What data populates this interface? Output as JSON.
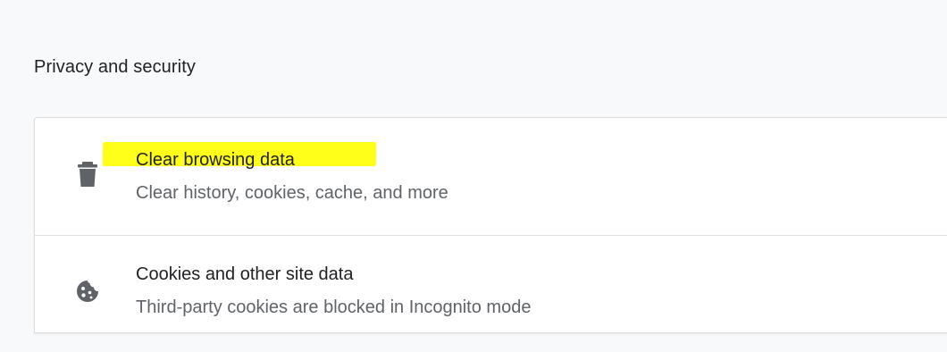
{
  "section": {
    "title": "Privacy and security"
  },
  "items": [
    {
      "title": "Clear browsing data",
      "subtitle": "Clear history, cookies, cache, and more",
      "icon": "trash-icon",
      "highlighted": true,
      "highlight_color": "#ffff00"
    },
    {
      "title": "Cookies and other site data",
      "subtitle": "Third-party cookies are blocked in Incognito mode",
      "icon": "cookie-icon"
    }
  ],
  "colors": {
    "background": "#f8f9fa",
    "card": "#ffffff",
    "text_primary": "#202124",
    "text_secondary": "#5f6368"
  }
}
